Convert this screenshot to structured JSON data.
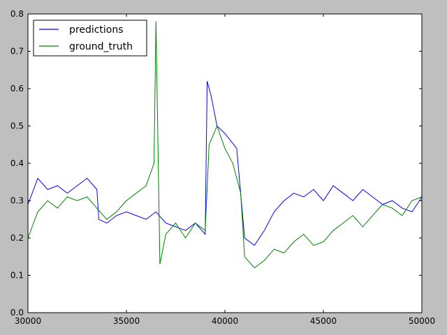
{
  "chart_data": {
    "type": "line",
    "title": "",
    "xlabel": "",
    "ylabel": "",
    "xlim": [
      30000,
      50000
    ],
    "ylim": [
      0.0,
      0.8
    ],
    "xticks": [
      30000,
      35000,
      40000,
      45000,
      50000
    ],
    "xtick_labels": [
      "30000",
      "35000",
      "40000",
      "45000",
      "50000"
    ],
    "yticks": [
      0.0,
      0.1,
      0.2,
      0.3,
      0.4,
      0.5,
      0.6,
      0.7,
      0.8
    ],
    "ytick_labels": [
      "0.0",
      "0.1",
      "0.2",
      "0.3",
      "0.4",
      "0.5",
      "0.6",
      "0.7",
      "0.8"
    ],
    "grid": false,
    "legend_position": "top-left",
    "series": [
      {
        "name": "predictions",
        "color": "#0000ff",
        "x": [
          30000,
          30500,
          31000,
          31500,
          32000,
          32500,
          33000,
          33500,
          33600,
          34000,
          34500,
          35000,
          35500,
          36000,
          36500,
          37000,
          37500,
          38000,
          38500,
          39000,
          39100,
          39300,
          39600,
          40000,
          40300,
          40600,
          41000,
          41500,
          42000,
          42500,
          43000,
          43500,
          44000,
          44500,
          45000,
          45500,
          46000,
          46500,
          47000,
          47500,
          48000,
          48500,
          49000,
          49500,
          50000
        ],
        "y": [
          0.29,
          0.36,
          0.33,
          0.34,
          0.32,
          0.34,
          0.36,
          0.33,
          0.25,
          0.24,
          0.26,
          0.27,
          0.26,
          0.25,
          0.27,
          0.24,
          0.23,
          0.22,
          0.24,
          0.21,
          0.62,
          0.58,
          0.5,
          0.48,
          0.46,
          0.44,
          0.2,
          0.18,
          0.22,
          0.27,
          0.3,
          0.32,
          0.31,
          0.33,
          0.3,
          0.34,
          0.32,
          0.3,
          0.33,
          0.31,
          0.29,
          0.3,
          0.28,
          0.27,
          0.31
        ]
      },
      {
        "name": "ground_truth",
        "color": "#008000",
        "x": [
          30000,
          30500,
          31000,
          31500,
          32000,
          32500,
          33000,
          33500,
          34000,
          34500,
          35000,
          35500,
          36000,
          36400,
          36500,
          36700,
          37000,
          37500,
          38000,
          38500,
          39000,
          39200,
          39600,
          40000,
          40400,
          40800,
          41000,
          41500,
          42000,
          42500,
          43000,
          43500,
          44000,
          44500,
          45000,
          45500,
          46000,
          46500,
          47000,
          47500,
          48000,
          48500,
          49000,
          49500,
          50000
        ],
        "y": [
          0.2,
          0.27,
          0.3,
          0.28,
          0.31,
          0.3,
          0.31,
          0.28,
          0.25,
          0.27,
          0.3,
          0.32,
          0.34,
          0.4,
          0.78,
          0.13,
          0.21,
          0.24,
          0.2,
          0.24,
          0.22,
          0.45,
          0.5,
          0.44,
          0.4,
          0.32,
          0.15,
          0.12,
          0.14,
          0.17,
          0.16,
          0.19,
          0.21,
          0.18,
          0.19,
          0.22,
          0.24,
          0.26,
          0.23,
          0.26,
          0.29,
          0.28,
          0.26,
          0.3,
          0.31
        ]
      }
    ]
  }
}
